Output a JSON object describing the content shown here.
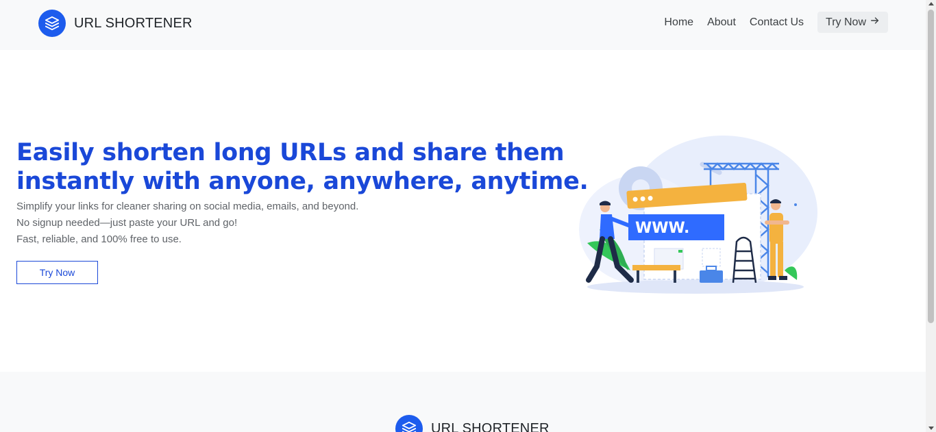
{
  "header": {
    "logo_text": "URL SHORTENER",
    "logo_icon": "layers-icon",
    "nav": [
      {
        "label": "Home"
      },
      {
        "label": "About"
      },
      {
        "label": "Contact Us"
      }
    ],
    "cta_label": "Try Now",
    "cta_icon": "arrow-right-icon"
  },
  "hero": {
    "title": "Easily shorten long URLs and share them instantly with anyone, anywhere, anytime.",
    "lines": [
      "Simplify your links for cleaner sharing on social media, emails, and beyond.",
      "No signup needed—just paste your URL and go!",
      "Fast, reliable, and 100% free to use."
    ],
    "button_label": "Try Now",
    "illustration": {
      "banner_text": "WWW."
    }
  },
  "footer": {
    "logo_text": "URL SHORTENER"
  },
  "colors": {
    "brand": "#1d5ced",
    "title": "#1a48d8",
    "header_bg": "#f8f9fa"
  }
}
